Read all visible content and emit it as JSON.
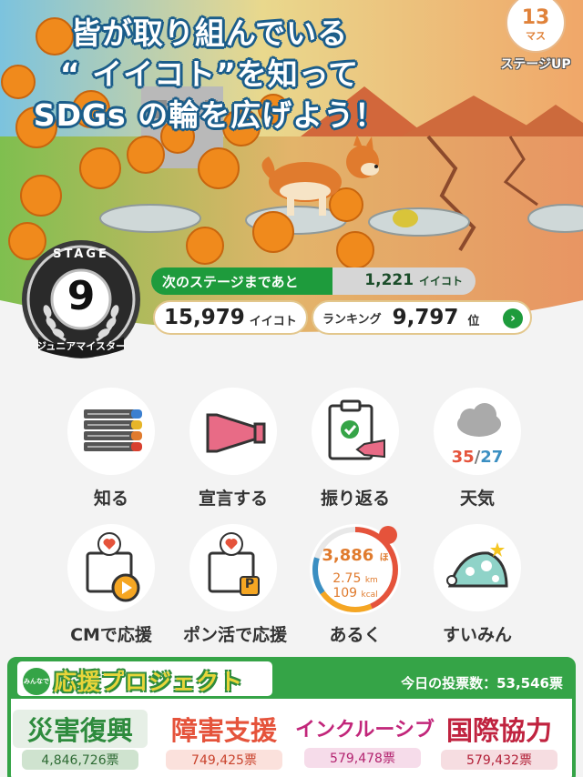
{
  "headline": {
    "line1": "皆が取り組んでいる",
    "line2": "“ イイコト”を知って",
    "line3": "SDGs の輪を広げよう！"
  },
  "stage_up": {
    "count": "13",
    "unit": "マス",
    "label": "ステージUP"
  },
  "badge": {
    "stage_word": "STAGE",
    "stage_number": "9",
    "rank_title": "ジュニアマイスター"
  },
  "next_stage": {
    "label": "次のステージまであと",
    "value": "1,221",
    "unit": "イイコト",
    "progress_fraction": 0.56
  },
  "points": {
    "value": "15,979",
    "unit": "イイコト"
  },
  "ranking": {
    "label": "ランキング",
    "value": "9,797",
    "unit": "位",
    "arrow": "›"
  },
  "menu": {
    "learn": "知る",
    "declare": "宣言する",
    "review": "振り返る",
    "weather": "天気",
    "weather_high": "35",
    "weather_sep": "/",
    "weather_low": "27",
    "cm_support": "CMで応援",
    "pon_support": "ポン活で応援",
    "walk": "あるく",
    "sleep": "すいみん",
    "p_badge": "P"
  },
  "walk_stats": {
    "steps": "3,886",
    "steps_unit": "ほ",
    "km": "2.75",
    "km_unit": "km",
    "kcal": "109",
    "kcal_unit": "kcal"
  },
  "project": {
    "mini_logo": "みんなで",
    "title": "応援プロジェクト",
    "votes_label": "今日の投票数：53,546票",
    "causes": [
      {
        "name": "災害復興",
        "count": "4,846,726票",
        "color": "#2e8b3d"
      },
      {
        "name": "障害支援",
        "count": "749,425票",
        "color": "#e5533b"
      },
      {
        "name": "インクルーシブ",
        "count": "579,478票",
        "color": "#c2267a"
      },
      {
        "name": "国際協力",
        "count": "579,432票",
        "color": "#c0233f"
      }
    ]
  },
  "colors": {
    "green": "#1e9b3c",
    "project_green": "#35a447",
    "orange": "#e0823a",
    "pink": "#e86b86"
  }
}
